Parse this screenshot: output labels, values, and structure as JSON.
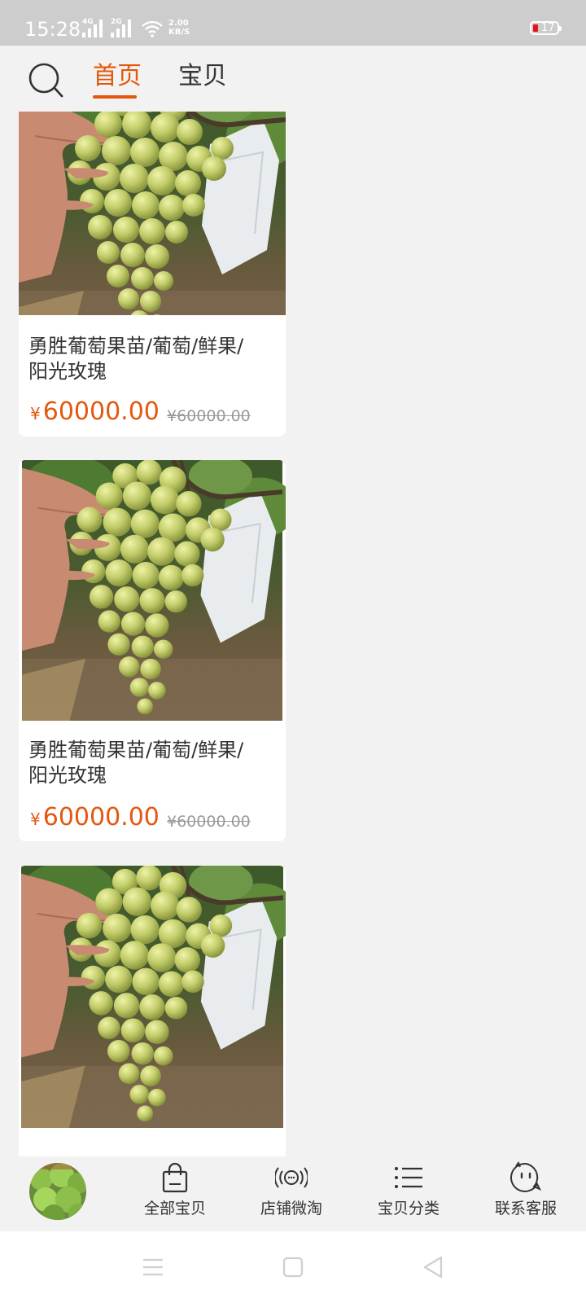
{
  "status_bar": {
    "time": "15:28",
    "signal_1": "4G",
    "signal_2": "2G",
    "net_speed_value": "2.00",
    "net_speed_unit": "KB/S",
    "battery_level": "17",
    "battery_color": "#e8131f"
  },
  "top_nav": {
    "search_icon": "search-icon",
    "tabs": [
      {
        "label": "首页",
        "active": true
      },
      {
        "label": "宝贝",
        "active": false
      }
    ],
    "accent_color": "#e4570e"
  },
  "products": [
    {
      "title_line1": "勇胜葡萄果苗/葡萄/鲜果/",
      "title_line2": "阳光玫瑰",
      "currency": "¥",
      "price": "60000.00",
      "original_price": "¥60000.00",
      "image": "green-grape-bunch-photo"
    },
    {
      "title_line1": "勇胜葡萄果苗/葡萄/鲜果/",
      "title_line2": "阳光玫瑰",
      "currency": "¥",
      "price": "60000.00",
      "original_price": "¥60000.00",
      "image": "green-grape-bunch-photo"
    },
    {
      "title_line1": "",
      "title_line2": "",
      "currency": "",
      "price": "",
      "original_price": "",
      "image": "green-grape-bunch-photo"
    }
  ],
  "bottom_bar": {
    "shop_avatar": "shop-logo-lettuce",
    "items": [
      {
        "label": "全部宝贝",
        "icon": "shopping-bag-icon"
      },
      {
        "label": "店铺微淘",
        "icon": "broadcast-icon"
      },
      {
        "label": "宝贝分类",
        "icon": "list-icon"
      },
      {
        "label": "联系客服",
        "icon": "chat-face-icon"
      }
    ]
  },
  "system_nav": {
    "buttons": [
      "menu-icon",
      "home-square-icon",
      "back-triangle-icon"
    ]
  }
}
